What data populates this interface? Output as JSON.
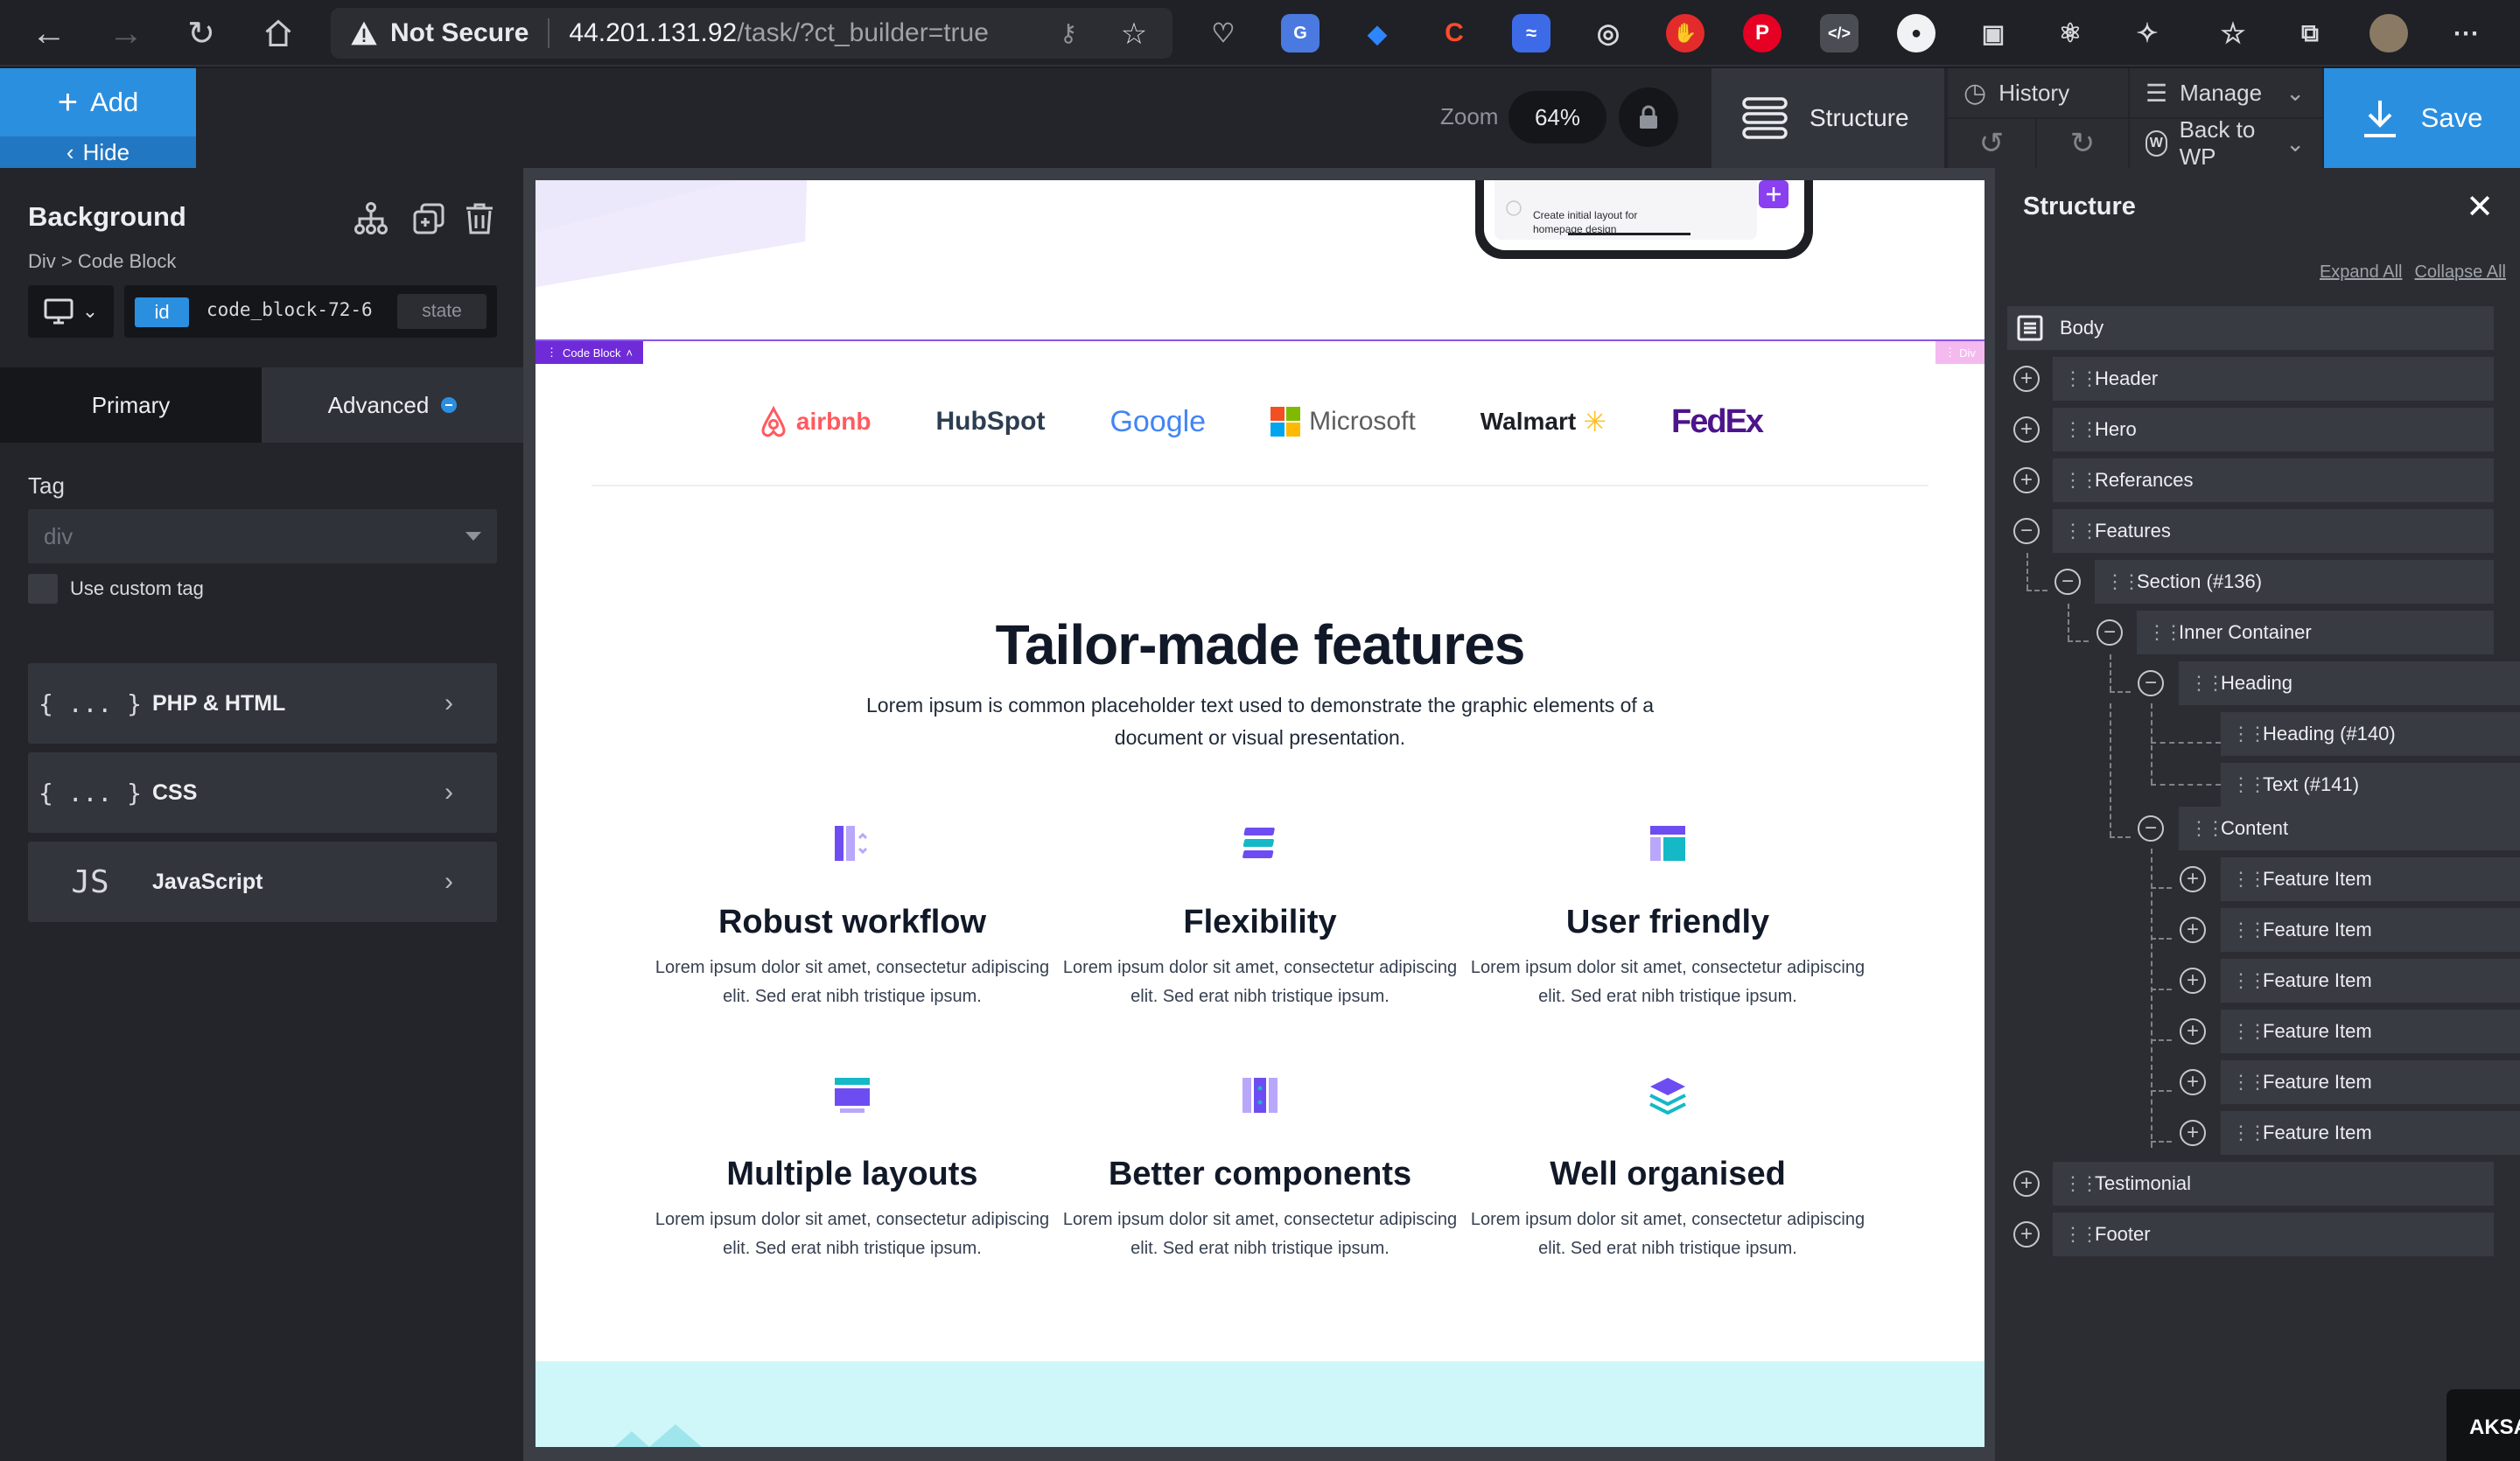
{
  "browser": {
    "security_label": "Not Secure",
    "url_host": "44.201.131.92",
    "url_path": "/task/?ct_builder=true"
  },
  "toolbar": {
    "add_label": "Add",
    "hide_label": "Hide",
    "zoom_label": "Zoom",
    "zoom_value": "64%",
    "structure_label": "Structure",
    "history_label": "History",
    "manage_label": "Manage",
    "back_to_wp_label": "Back to WP",
    "save_label": "Save"
  },
  "left_panel": {
    "title": "Background",
    "breadcrumb": "Div > Code Block",
    "id_badge": "id",
    "id_value": "code_block-72-6",
    "state_label": "state",
    "tabs": [
      {
        "label": "Primary"
      },
      {
        "label": "Advanced"
      }
    ],
    "tag_label": "Tag",
    "tag_value": "div",
    "custom_tag_label": "Use custom tag",
    "code_sections": [
      {
        "icon": "{ ... }",
        "label": "PHP & HTML"
      },
      {
        "icon": "{ ... }",
        "label": "CSS"
      },
      {
        "icon": "JS",
        "label": "JavaScript"
      }
    ]
  },
  "canvas": {
    "phone_task_text": "Create initial layout for homepage design",
    "code_block_tag": "Code Block",
    "div_tag": "Div",
    "logos": [
      "airbnb",
      "HubSpot",
      "Google",
      "Microsoft",
      "Walmart",
      "FedEx"
    ],
    "section_title": "Tailor-made features",
    "section_subtitle": "Lorem ipsum is common placeholder text used to demonstrate the graphic elements of a document or visual presentation.",
    "features": [
      {
        "title": "Robust workflow",
        "text": "Lorem ipsum dolor sit amet, consectetur adipiscing elit. Sed erat nibh tristique ipsum."
      },
      {
        "title": "Flexibility",
        "text": "Lorem ipsum dolor sit amet, consectetur adipiscing elit. Sed erat nibh tristique ipsum."
      },
      {
        "title": "User friendly",
        "text": "Lorem ipsum dolor sit amet, consectetur adipiscing elit. Sed erat nibh tristique ipsum."
      },
      {
        "title": "Multiple layouts",
        "text": "Lorem ipsum dolor sit amet, consectetur adipiscing elit. Sed erat nibh tristique ipsum."
      },
      {
        "title": "Better components",
        "text": "Lorem ipsum dolor sit amet, consectetur adipiscing elit. Sed erat nibh tristique ipsum."
      },
      {
        "title": "Well organised",
        "text": "Lorem ipsum dolor sit amet, consectetur adipiscing elit. Sed erat nibh tristique ipsum."
      }
    ]
  },
  "structure_panel": {
    "title": "Structure",
    "expand_all": "Expand All",
    "collapse_all": "Collapse All",
    "nodes": [
      {
        "label": "Body"
      },
      {
        "label": "Header"
      },
      {
        "label": "Hero"
      },
      {
        "label": "Referances"
      },
      {
        "label": "Features"
      },
      {
        "label": "Section (#136)"
      },
      {
        "label": "Inner Container"
      },
      {
        "label": "Heading"
      },
      {
        "label": "Heading (#140)"
      },
      {
        "label": "Text (#141)"
      },
      {
        "label": "Content"
      },
      {
        "label": "Feature Item"
      },
      {
        "label": "Feature Item"
      },
      {
        "label": "Feature Item"
      },
      {
        "label": "Feature Item"
      },
      {
        "label": "Feature Item"
      },
      {
        "label": "Feature Item"
      },
      {
        "label": "Testimonial"
      },
      {
        "label": "Footer"
      }
    ]
  },
  "corner_badge": "AKSA",
  "colors": {
    "accent": "#2b8fe0",
    "selection": "#6f2bd8",
    "panel": "#23252b",
    "icon_purple": "#6d4df2",
    "icon_teal": "#15b8c6"
  }
}
